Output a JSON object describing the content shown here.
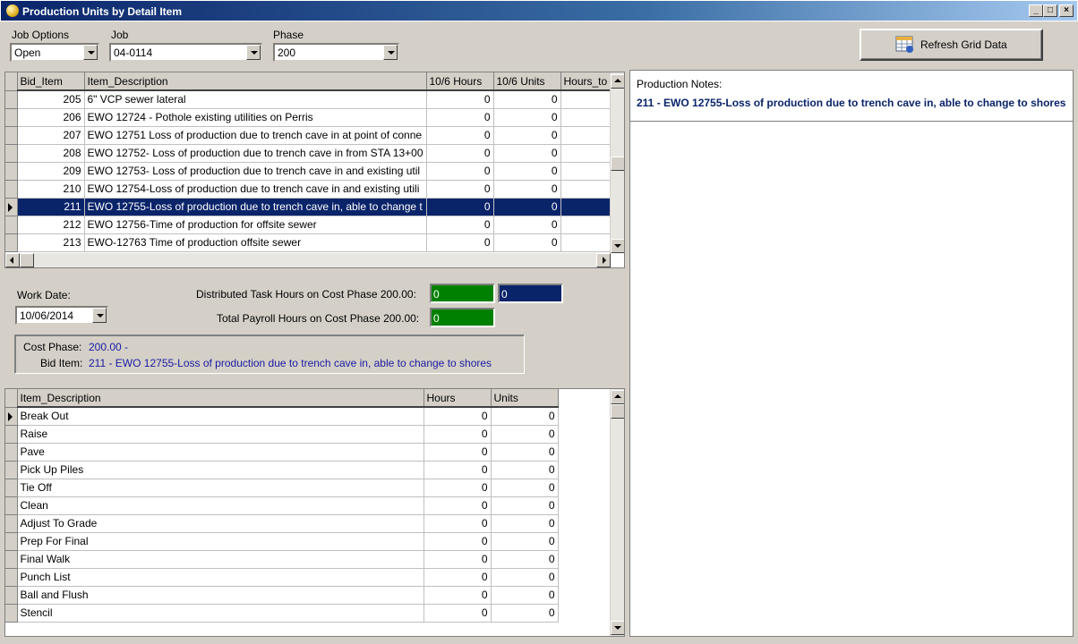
{
  "window": {
    "title": "Production Units by Detail Item",
    "icon": "app-icon",
    "controls": [
      "_",
      "□",
      "×"
    ]
  },
  "filters": {
    "job_options_label": "Job Options",
    "job_options_value": "Open",
    "job_label": "Job",
    "job_value": "04-0114",
    "phase_label": "Phase",
    "phase_value": "200"
  },
  "refresh_button": {
    "label": "Refresh Grid Data",
    "icon": "grid-refresh-icon"
  },
  "bid_grid": {
    "columns": [
      "Bid_Item",
      "Item_Description",
      "10/6 Hours",
      "10/6 Units",
      "Hours_to"
    ],
    "rows": [
      {
        "bid_item": "205",
        "description": "6\" VCP sewer lateral",
        "hours": "0",
        "units": "0"
      },
      {
        "bid_item": "206",
        "description": "EWO 12724 - Pothole existing utilities on Perris",
        "hours": "0",
        "units": "0"
      },
      {
        "bid_item": "207",
        "description": "EWO 12751 Loss of production due to trench cave in at point of conne",
        "hours": "0",
        "units": "0"
      },
      {
        "bid_item": "208",
        "description": "EWO 12752- Loss of production due to trench cave in from STA 13+00",
        "hours": "0",
        "units": "0"
      },
      {
        "bid_item": "209",
        "description": "EWO 12753- Loss of production due to trench cave in and existing util",
        "hours": "0",
        "units": "0"
      },
      {
        "bid_item": "210",
        "description": "EWO 12754-Loss of production due to trench cave in and existing utili",
        "hours": "0",
        "units": "0"
      },
      {
        "bid_item": "211",
        "description": "EWO 12755-Loss of production due to trench cave in, able to change t",
        "hours": "0",
        "units": "0"
      },
      {
        "bid_item": "212",
        "description": "EWO 12756-Time of production for offsite sewer",
        "hours": "0",
        "units": "0"
      },
      {
        "bid_item": "213",
        "description": "EWO-12763 Time of production offsite sewer",
        "hours": "0",
        "units": "0"
      }
    ],
    "selected_index": 6
  },
  "notes": {
    "label": "Production Notes:",
    "text": "211 - EWO 12755-Loss of production due to trench cave in, able to change to shores"
  },
  "work_date": {
    "label": "Work Date:",
    "value": "10/06/2014"
  },
  "totals": {
    "distributed_label": "Distributed Task Hours on Cost Phase 200.00:",
    "distributed_value": "0",
    "distributed_value2": "0",
    "payroll_label": "Total Payroll Hours on Cost Phase 200.00:",
    "payroll_value": "0",
    "green": "#008000",
    "navy": "#0a246a"
  },
  "summary": {
    "cost_phase_label": "Cost Phase:",
    "cost_phase_value": "200.00 -",
    "bid_item_label": "Bid Item:",
    "bid_item_value": "211 - EWO 12755-Loss of production due to trench cave in, able to change to shores"
  },
  "task_grid": {
    "columns": [
      "Item_Description",
      "Hours",
      "Units"
    ],
    "rows": [
      {
        "description": "Break Out",
        "hours": "0",
        "units": "0"
      },
      {
        "description": "Raise",
        "hours": "0",
        "units": "0"
      },
      {
        "description": "Pave",
        "hours": "0",
        "units": "0"
      },
      {
        "description": "Pick Up Piles",
        "hours": "0",
        "units": "0"
      },
      {
        "description": "Tie Off",
        "hours": "0",
        "units": "0"
      },
      {
        "description": "Clean",
        "hours": "0",
        "units": "0"
      },
      {
        "description": "Adjust To Grade",
        "hours": "0",
        "units": "0"
      },
      {
        "description": "Prep For Final",
        "hours": "0",
        "units": "0"
      },
      {
        "description": "Final Walk",
        "hours": "0",
        "units": "0"
      },
      {
        "description": "Punch List",
        "hours": "0",
        "units": "0"
      },
      {
        "description": "Ball and Flush",
        "hours": "0",
        "units": "0"
      },
      {
        "description": "Stencil",
        "hours": "0",
        "units": "0"
      }
    ],
    "current_index": 0
  }
}
